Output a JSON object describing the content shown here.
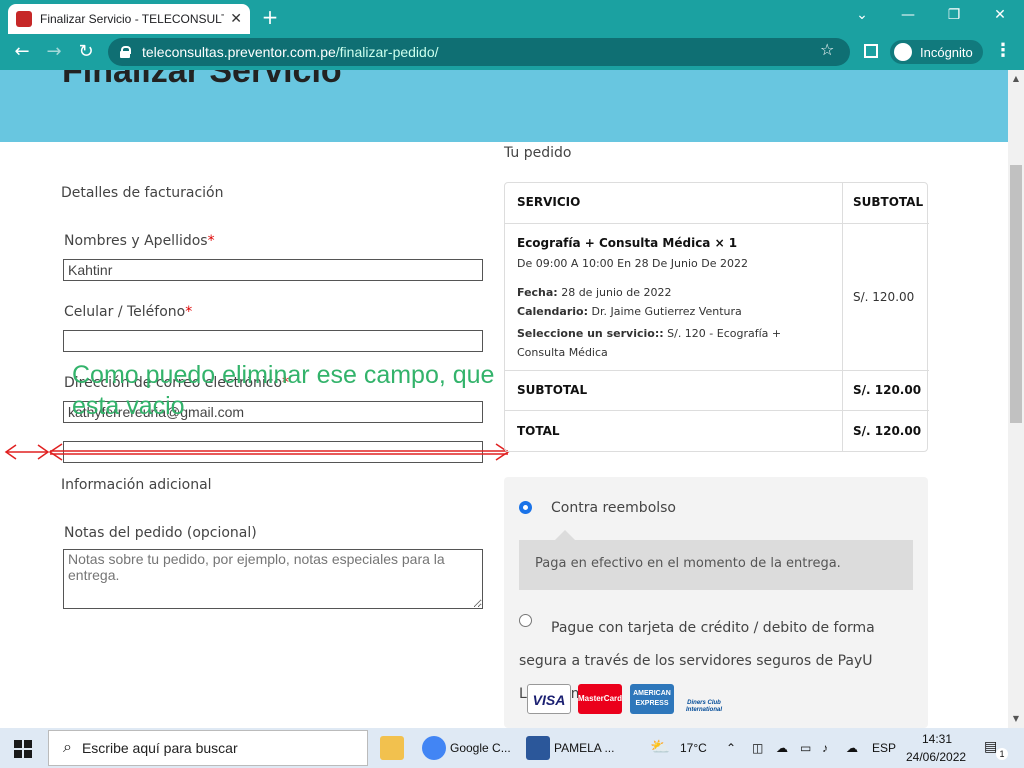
{
  "browser": {
    "tab_title": "Finalizar Servicio - TELECONSULTAS",
    "tab_close": "✕",
    "new_tab": "+",
    "url_host": "teleconsultas.preventor.com.pe",
    "url_path": "/finalizar-pedido/",
    "incognito_label": "Incógnito",
    "icons": [
      "back-icon",
      "forward-icon",
      "reload-icon",
      "lock-icon",
      "star-icon",
      "side-panel-icon",
      "incognito-icon",
      "menu-icon"
    ]
  },
  "page": {
    "hero_title": "Finalizar Servicio",
    "billing_heading": "Detalles de facturación",
    "fields": {
      "name_label": "Nombres y Apellidos",
      "name_value": "Kahtinr",
      "phone_label": "Celular / Teléfono",
      "phone_value": "",
      "email_label": "Dirección de correo electrónico",
      "email_value": "kathyferrereuria@gmail.com",
      "required_mark": "*"
    },
    "annotation": "Como puedo eliminar ese campo, que esta vacio",
    "additional_heading": "Información adicional",
    "notes_label": "Notas del pedido (opcional)",
    "notes_placeholder": "Notas sobre tu pedido, por ejemplo, notas especiales para la entrega.",
    "order": {
      "heading": "Tu pedido",
      "col_service": "SERVICIO",
      "col_subtotal": "SUBTOTAL",
      "item_title": "Ecografía + Consulta Médica × 1",
      "item_schedule": "De 09:00 A 10:00 En 28 De Junio De 2022",
      "fecha_label": "Fecha:",
      "fecha_value": "28 de junio de 2022",
      "calendario_label": "Calendario:",
      "calendario_value": "Dr. Jaime Gutierrez Ventura",
      "servicio_label": "Seleccione un servicio::",
      "servicio_value": "S/. 120 - Ecografía + Consulta Médica",
      "item_price": "S/. 120.00",
      "subtotal_label": "SUBTOTAL",
      "subtotal_value": "S/. 120.00",
      "total_label": "TOTAL",
      "total_value": "S/. 120.00"
    },
    "payment": {
      "option1": "Contra reembolso",
      "option1_desc": "Paga en efectivo en el momento de la entrega.",
      "option2": "Pague con tarjeta de crédito / debito de forma segura a través de los servidores seguros de PayU Latinoamérica.",
      "cards": [
        "VISA",
        "MasterCard",
        "AMERICAN EXPRESS",
        "Diners Club International"
      ]
    }
  },
  "taskbar": {
    "search_placeholder": "Escribe aquí para buscar",
    "chrome_label": "Google C...",
    "word_label": "PAMELA ...",
    "temperature": "17°C",
    "language": "ESP",
    "time": "14:31",
    "date": "24/06/2022",
    "notification_count": "1"
  }
}
